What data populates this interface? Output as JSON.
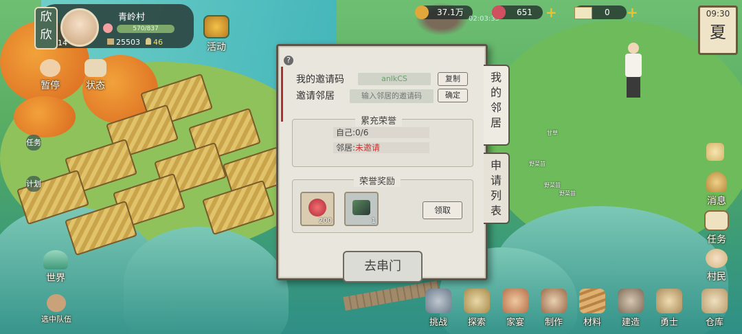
{
  "profile": {
    "name": "欣欣",
    "level": "14",
    "village": "青岭村",
    "xp": "570/837",
    "coins": "25503",
    "population": "46"
  },
  "resources": {
    "copper": "37.1万",
    "flowers": "651",
    "tickets": "0",
    "timer": "02:03:35"
  },
  "clock": {
    "time": "09:30",
    "season": "夏"
  },
  "left_buttons": {
    "activity": "活动",
    "pause": "暂停",
    "status": "状态",
    "task": "任务",
    "plan": "计划",
    "world": "世界",
    "team": "选中队伍"
  },
  "right_buttons": {
    "message": "消息",
    "task": "任务",
    "villager": "村民"
  },
  "bottom_buttons": [
    "挑战",
    "探索",
    "家宴",
    "制作",
    "材料",
    "建造",
    "勇士",
    "仓库"
  ],
  "dialog": {
    "help": "?",
    "my_code_label": "我的邀请码",
    "my_code_value": "anlkCS",
    "copy_label": "复制",
    "invite_label": "邀请邻居",
    "invite_placeholder": "输入邻居的邀请码",
    "confirm_label": "确定",
    "honor_title": "累充荣誉",
    "self_text": "自己:0/6",
    "neighbor_prefix": "邻居:",
    "neighbor_status": "未邀请",
    "reward_title": "荣誉奖励",
    "reward_items": [
      {
        "icon": "red-flower-token-icon",
        "count": "200"
      },
      {
        "icon": "jade-stone-icon",
        "count": "1"
      }
    ],
    "claim_label": "领取",
    "visit_label": "去串门"
  },
  "tabs": {
    "my_neighbors": "我的邻居",
    "apply_list": "申请列表"
  },
  "plants": [
    "甘草",
    "野菜苗",
    "野菜苗",
    "野菜苗"
  ],
  "colors": {
    "accent": "#f0c030",
    "red_text": "#d03030"
  }
}
